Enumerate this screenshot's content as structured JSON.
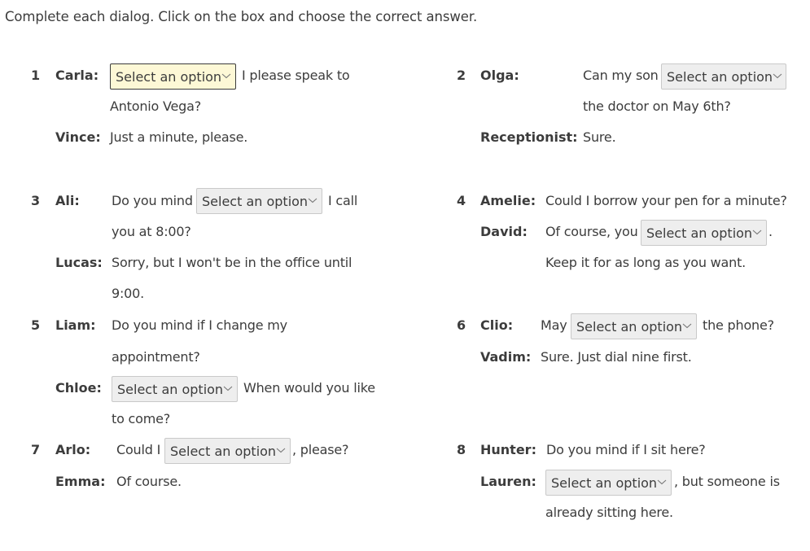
{
  "instructions": "Complete each dialog. Click on the box and choose the correct answer.",
  "select_placeholder": "Select an option",
  "dialogs": [
    {
      "number": "1",
      "lines": [
        {
          "speaker": "Carla:",
          "before": "",
          "after": "I please speak to",
          "cont": "Antonio Vega?"
        },
        {
          "speaker": "Vince:",
          "text": "Just a minute, please."
        }
      ]
    },
    {
      "number": "2",
      "lines": [
        {
          "speaker": "Olga:",
          "before": "Can my son",
          "after": "",
          "cont": "the doctor on May 6th?"
        },
        {
          "speaker": "Receptionist:",
          "text": "Sure."
        }
      ]
    },
    {
      "number": "3",
      "lines": [
        {
          "speaker": "Ali:",
          "before": "Do you mind",
          "after": "I call",
          "cont": "you at 8:00?"
        },
        {
          "speaker": "Lucas:",
          "text": "Sorry, but I won't be in the office until",
          "cont": "9:00."
        }
      ]
    },
    {
      "number": "4",
      "lines": [
        {
          "speaker": "Amelie:",
          "text": "Could I borrow your pen for a minute?"
        },
        {
          "speaker": "David:",
          "before": "Of course, you",
          "after": ".",
          "cont": "Keep it for as long as you want."
        }
      ]
    },
    {
      "number": "5",
      "lines": [
        {
          "speaker": "Liam:",
          "text": "Do you mind if I change my",
          "cont": "appointment?"
        },
        {
          "speaker": "Chloe:",
          "before": "",
          "after": "When would you like",
          "cont": "to come?"
        }
      ]
    },
    {
      "number": "6",
      "lines": [
        {
          "speaker": "Clio:",
          "before": "May",
          "after": "the phone?"
        },
        {
          "speaker": "Vadim:",
          "text": "Sure. Just dial nine first."
        }
      ]
    },
    {
      "number": "7",
      "lines": [
        {
          "speaker": "Arlo:",
          "before": "Could I",
          "after": ", please?"
        },
        {
          "speaker": "Emma:",
          "text": "Of course."
        }
      ]
    },
    {
      "number": "8",
      "lines": [
        {
          "speaker": "Hunter:",
          "text": "Do you mind if I sit here?"
        },
        {
          "speaker": "Lauren:",
          "before": "",
          "after": ", but someone is",
          "cont": "already sitting here."
        }
      ]
    }
  ]
}
